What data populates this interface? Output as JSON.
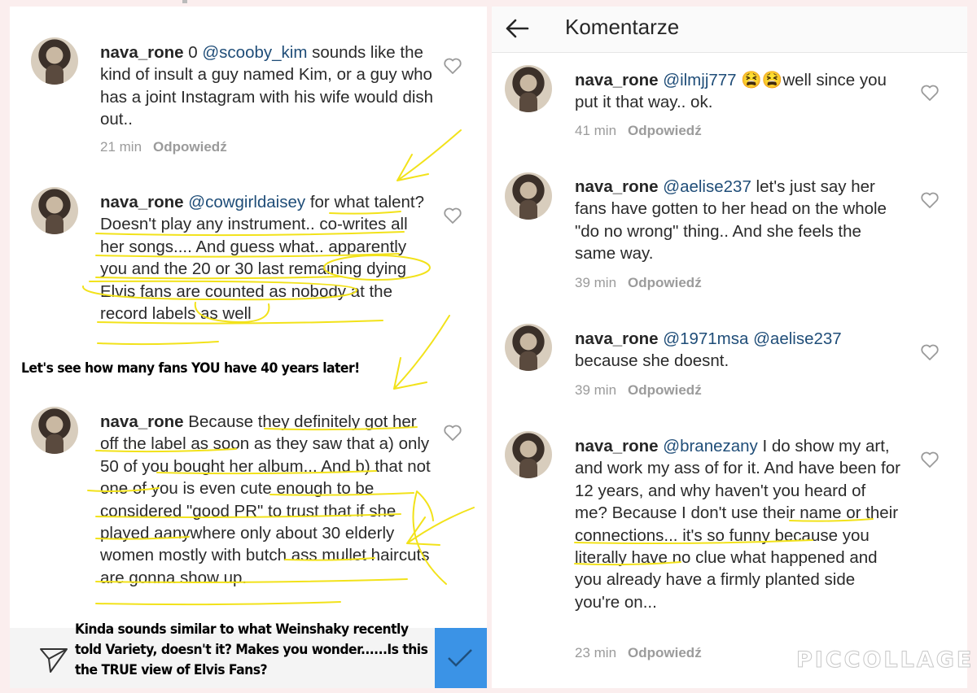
{
  "left_panel": {
    "comments": [
      {
        "username": "nava_rone",
        "body_segments": [
          {
            "text": "0 ",
            "mention": false
          },
          {
            "text": "@scooby_kim",
            "mention": true
          },
          {
            "text": " sounds like the kind of insult a guy named Kim, or a guy who has a joint Instagram with his wife would dish out..",
            "mention": false
          }
        ],
        "time": "21 min",
        "reply_label": "Odpowiedź"
      },
      {
        "username": "nava_rone",
        "body_segments": [
          {
            "text": "@cowgirldaisey",
            "mention": true
          },
          {
            "text": " for what talent? Doesn't play any instrument.. co-writes all her songs.... And guess what.. apparently you and the 20 or 30 last remaining dying Elvis fans are counted as nobody at the record labels as well",
            "mention": false
          }
        ],
        "time": "",
        "reply_label": ""
      },
      {
        "username": "nava_rone",
        "body_segments": [
          {
            "text": "Because they definitely got her off the label as soon as they saw that a) only 50 of you bought her album... And b) that  not one of you is even cute enough to be considered \"good PR\" to trust that if she played aanywhere only about 30 elderly women mostly with butch ass mullet haircuts  are gonna show up.",
            "mention": false
          }
        ],
        "time": "",
        "reply_label": ""
      }
    ],
    "annotation_1": "Let's see how many fans YOU have 40 years later!",
    "annotation_2": "Kinda sounds similar to what Weinshaky recently told Variety, doesn't it? Makes you wonder......Is this the TRUE view of Elvis Fans?"
  },
  "right_panel": {
    "header": {
      "back_icon": "back-arrow-icon",
      "title": "Komentarze"
    },
    "comments": [
      {
        "username": "nava_rone",
        "body_segments": [
          {
            "text": "@ilmjj777",
            "mention": true
          },
          {
            "text": " 😫😫well since you put it that way.. ok.",
            "mention": false
          }
        ],
        "time": "41 min",
        "reply_label": "Odpowiedź"
      },
      {
        "username": "nava_rone",
        "body_segments": [
          {
            "text": "@aelise237",
            "mention": true
          },
          {
            "text": " let's just say her fans have gotten to her head on the whole \"do no wrong\" thing.. And she feels the same way.",
            "mention": false
          }
        ],
        "time": "39 min",
        "reply_label": "Odpowiedź"
      },
      {
        "username": "nava_rone",
        "body_segments": [
          {
            "text": "@1971msa @aelise237",
            "mention": true
          },
          {
            "text": " because she doesnt.",
            "mention": false
          }
        ],
        "time": "39 min",
        "reply_label": "Odpowiedź"
      },
      {
        "username": "nava_rone",
        "body_segments": [
          {
            "text": "@branezany",
            "mention": true
          },
          {
            "text": " I do show my art, and work my ass of for it. And have been for 12 years, and why haven't you heard of me? Because I don't use their name or their connections... it's so funny because you literally have no clue what happened and you already have a firmly planted side you're on...",
            "mention": false
          }
        ],
        "time": "23 min",
        "reply_label": "Odpowiedź"
      }
    ]
  },
  "watermark": "PICCOLLAGE",
  "colors": {
    "mention": "#1f4d78",
    "highlight": "#f2e21a",
    "send_button": "#3b93e6",
    "meta": "#9b9b9b"
  }
}
